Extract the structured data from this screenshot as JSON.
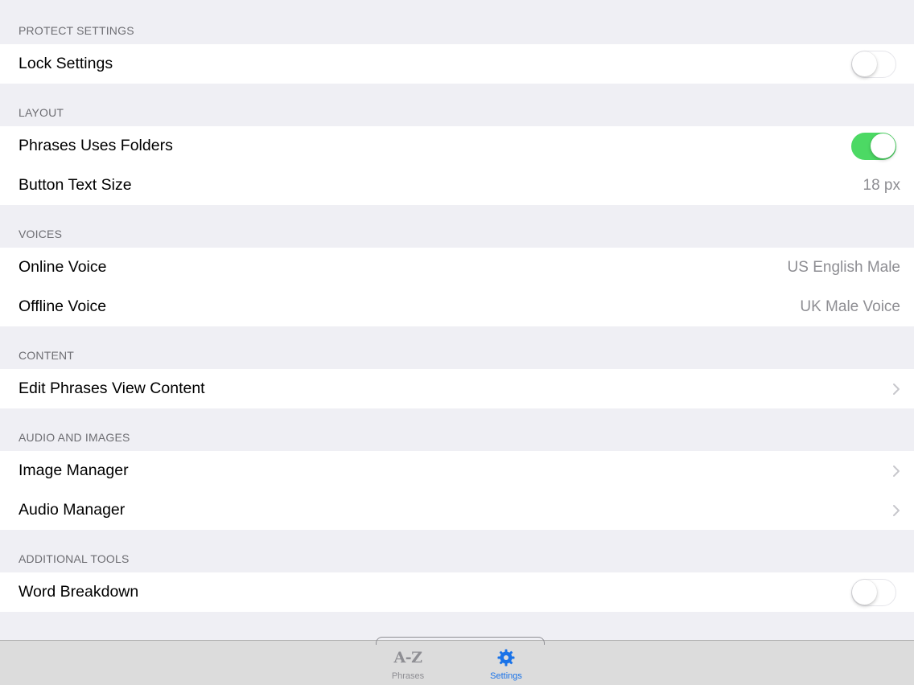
{
  "sections": {
    "protect": {
      "header": "PROTECT SETTINGS",
      "lock_settings": {
        "label": "Lock Settings",
        "toggle": "off"
      }
    },
    "layout": {
      "header": "LAYOUT",
      "phrases_uses_folders": {
        "label": "Phrases Uses Folders",
        "toggle": "on"
      },
      "button_text_size": {
        "label": "Button Text Size",
        "value": "18 px"
      }
    },
    "voices": {
      "header": "VOICES",
      "online_voice": {
        "label": "Online Voice",
        "value": "US English Male"
      },
      "offline_voice": {
        "label": "Offline Voice",
        "value": "UK Male Voice"
      }
    },
    "content": {
      "header": "CONTENT",
      "edit_phrases_view_content": {
        "label": "Edit Phrases View Content"
      }
    },
    "audio_images": {
      "header": "AUDIO AND IMAGES",
      "image_manager": {
        "label": "Image Manager"
      },
      "audio_manager": {
        "label": "Audio Manager"
      }
    },
    "additional_tools": {
      "header": "ADDITIONAL TOOLS",
      "word_breakdown": {
        "label": "Word Breakdown",
        "toggle": "off"
      }
    }
  },
  "tabbar": {
    "phrases": {
      "icon_text": "A-Z",
      "label": "Phrases",
      "icon": "az-icon",
      "selected": false
    },
    "settings": {
      "label": "Settings",
      "icon": "gear-icon",
      "selected": true
    }
  },
  "colors": {
    "background": "#efeff4",
    "toggle_on": "#4cd964",
    "accent": "#1a73e8",
    "secondary_text": "#8e8e93",
    "section_header": "#6d6d72"
  }
}
